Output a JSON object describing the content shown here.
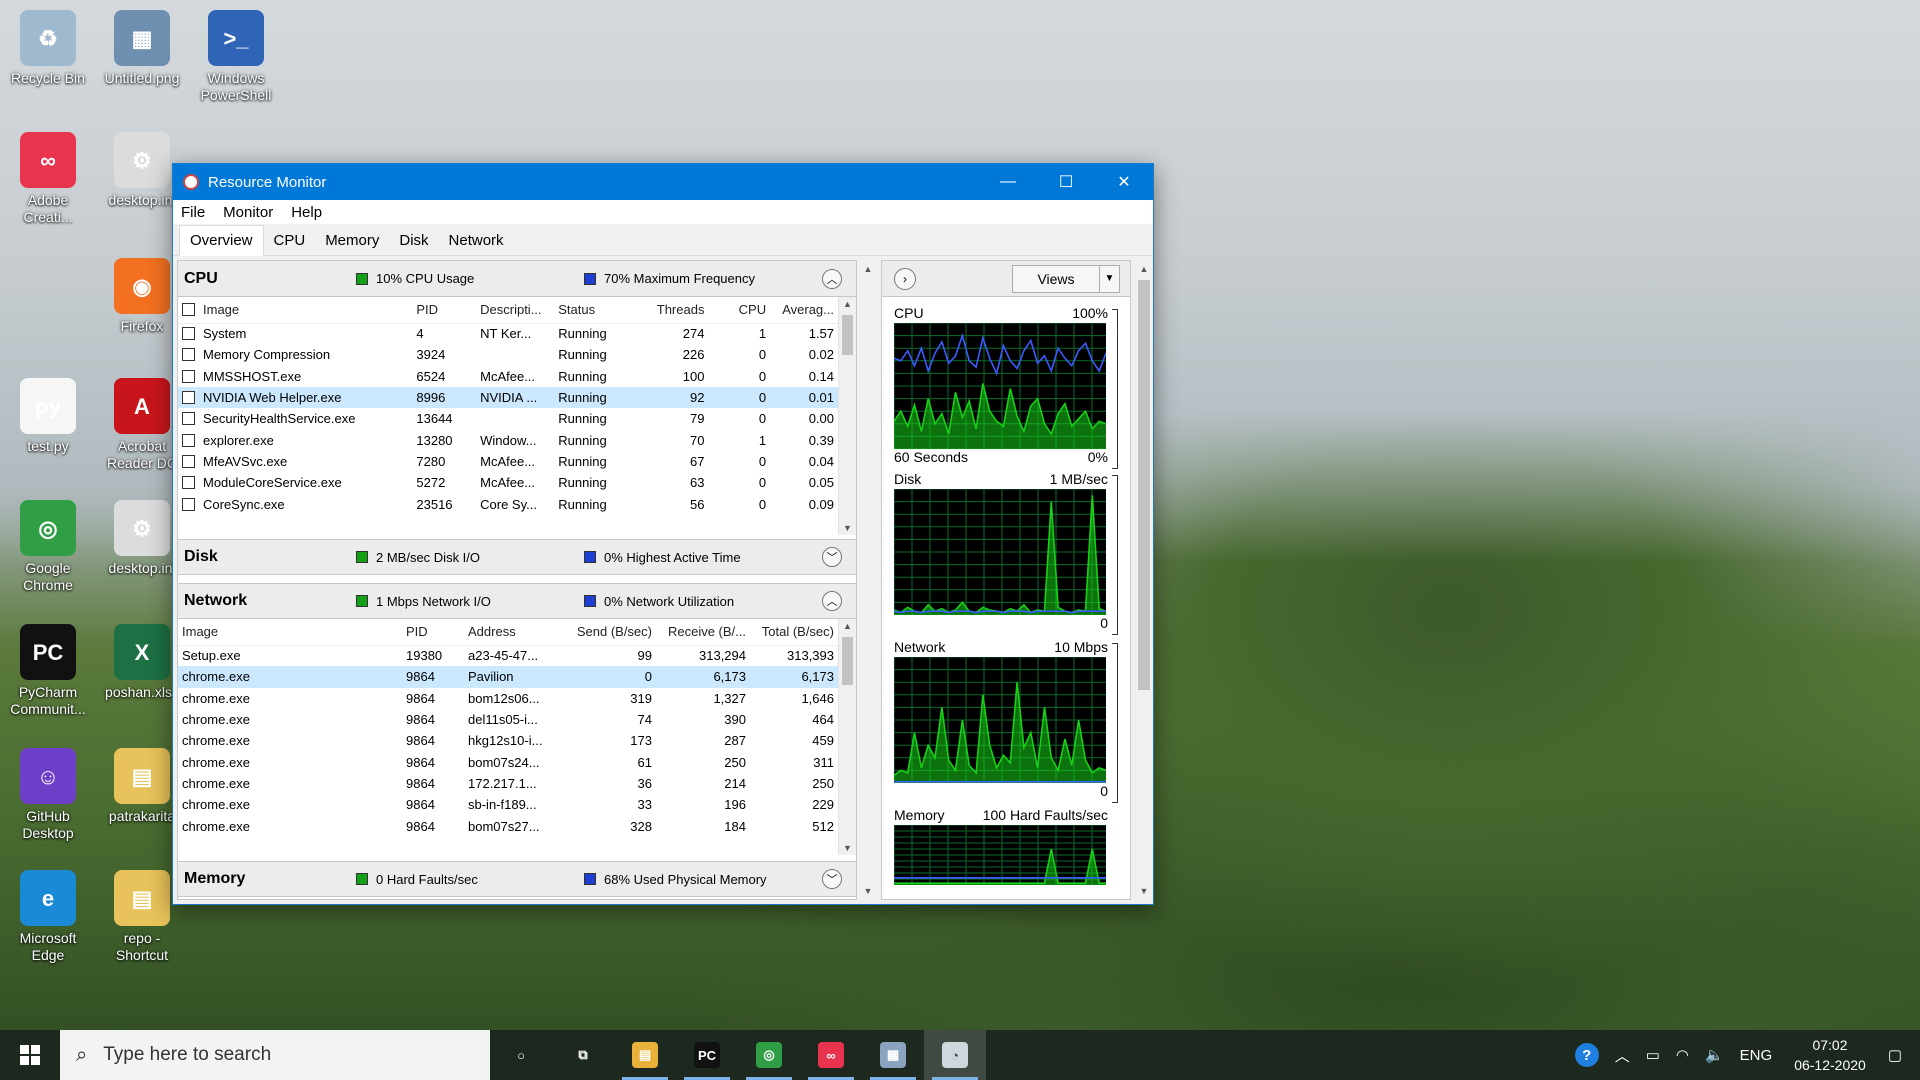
{
  "desktop_icons": [
    {
      "label": "Recycle Bin",
      "icon": "recycle-bin-icon",
      "color": "#9fb9cf",
      "glyph": "♻"
    },
    {
      "label": "Untitled.png",
      "icon": "image-file-icon",
      "color": "#6f8fb0",
      "glyph": "▦"
    },
    {
      "label": "Windows PowerShell",
      "icon": "powershell-icon",
      "color": "#2f64b7",
      "glyph": ">_"
    },
    {
      "label": "Adobe Creati...",
      "icon": "adobe-creative-cloud-icon",
      "color": "#e8344e",
      "glyph": "∞"
    },
    {
      "label": "desktop.ini",
      "icon": "settings-file-icon",
      "color": "#dcdcdc",
      "glyph": "⚙"
    },
    {
      "label": "Firefox",
      "icon": "firefox-icon",
      "color": "#f2701f",
      "glyph": "◉"
    },
    {
      "label": "test.py",
      "icon": "python-file-icon",
      "color": "#f6f6f6",
      "glyph": "py"
    },
    {
      "label": "Acrobat Reader DC",
      "icon": "acrobat-icon",
      "color": "#c8151b",
      "glyph": "A"
    },
    {
      "label": "Google Chrome",
      "icon": "chrome-icon",
      "color": "#2f9e45",
      "glyph": "◎"
    },
    {
      "label": "desktop.ini",
      "icon": "settings-file-icon",
      "color": "#dcdcdc",
      "glyph": "⚙"
    },
    {
      "label": "PyCharm Communit...",
      "icon": "pycharm-icon",
      "color": "#111111",
      "glyph": "PC"
    },
    {
      "label": "poshan.xlsx",
      "icon": "excel-file-icon",
      "color": "#1d7044",
      "glyph": "X"
    },
    {
      "label": "GitHub Desktop",
      "icon": "github-desktop-icon",
      "color": "#6e40c9",
      "glyph": "☺"
    },
    {
      "label": "patrakarita",
      "icon": "folder-icon",
      "color": "#e8c25a",
      "glyph": "▤"
    },
    {
      "label": "Microsoft Edge",
      "icon": "edge-icon",
      "color": "#1b8ad6",
      "glyph": "e"
    },
    {
      "label": "repo - Shortcut",
      "icon": "folder-shortcut-icon",
      "color": "#e8c25a",
      "glyph": "▤"
    }
  ],
  "window": {
    "title": "Resource Monitor",
    "minimize": "—",
    "maximize": "☐",
    "close": "✕",
    "menu": [
      "File",
      "Monitor",
      "Help"
    ],
    "tabs": [
      "Overview",
      "CPU",
      "Memory",
      "Disk",
      "Network"
    ],
    "active_tab": "Overview"
  },
  "cpu": {
    "title": "CPU",
    "stat1": "10% CPU Usage",
    "stat2": "70% Maximum Frequency",
    "columns": [
      "Image",
      "PID",
      "Descripti...",
      "Status",
      "Threads",
      "CPU",
      "Averag..."
    ],
    "rows": [
      [
        "System",
        "4",
        "NT Ker...",
        "Running",
        "274",
        "1",
        "1.57"
      ],
      [
        "Memory Compression",
        "3924",
        "",
        "Running",
        "226",
        "0",
        "0.02"
      ],
      [
        "MMSSHOST.exe",
        "6524",
        "McAfee...",
        "Running",
        "100",
        "0",
        "0.14"
      ],
      [
        "NVIDIA Web Helper.exe",
        "8996",
        "NVIDIA ...",
        "Running",
        "92",
        "0",
        "0.01"
      ],
      [
        "SecurityHealthService.exe",
        "13644",
        "",
        "Running",
        "79",
        "0",
        "0.00"
      ],
      [
        "explorer.exe",
        "13280",
        "Window...",
        "Running",
        "70",
        "1",
        "0.39"
      ],
      [
        "MfeAVSvc.exe",
        "7280",
        "McAfee...",
        "Running",
        "67",
        "0",
        "0.04"
      ],
      [
        "ModuleCoreService.exe",
        "5272",
        "McAfee...",
        "Running",
        "63",
        "0",
        "0.05"
      ],
      [
        "CoreSync.exe",
        "23516",
        "Core Sy...",
        "Running",
        "56",
        "0",
        "0.09"
      ]
    ],
    "selected_row": 3
  },
  "disk": {
    "title": "Disk",
    "stat1": "2 MB/sec Disk I/O",
    "stat2": "0% Highest Active Time"
  },
  "network": {
    "title": "Network",
    "stat1": "1 Mbps Network I/O",
    "stat2": "0% Network Utilization",
    "columns": [
      "Image",
      "PID",
      "Address",
      "Send (B/sec)",
      "Receive (B/...",
      "Total (B/sec)"
    ],
    "rows": [
      [
        "Setup.exe",
        "19380",
        "a23-45-47...",
        "99",
        "313,294",
        "313,393"
      ],
      [
        "chrome.exe",
        "9864",
        "Pavilion",
        "0",
        "6,173",
        "6,173"
      ],
      [
        "chrome.exe",
        "9864",
        "bom12s06...",
        "319",
        "1,327",
        "1,646"
      ],
      [
        "chrome.exe",
        "9864",
        "del11s05-i...",
        "74",
        "390",
        "464"
      ],
      [
        "chrome.exe",
        "9864",
        "hkg12s10-i...",
        "173",
        "287",
        "459"
      ],
      [
        "chrome.exe",
        "9864",
        "bom07s24...",
        "61",
        "250",
        "311"
      ],
      [
        "chrome.exe",
        "9864",
        "172.217.1...",
        "36",
        "214",
        "250"
      ],
      [
        "chrome.exe",
        "9864",
        "sb-in-f189...",
        "33",
        "196",
        "229"
      ],
      [
        "chrome.exe",
        "9864",
        "bom07s27...",
        "328",
        "184",
        "512"
      ]
    ],
    "selected_row": 1
  },
  "memory": {
    "title": "Memory",
    "stat1": "0 Hard Faults/sec",
    "stat2": "68% Used Physical Memory"
  },
  "graphs": {
    "views_label": "Views",
    "cpu": {
      "label": "CPU",
      "max": "100%",
      "foot_left": "60 Seconds",
      "foot_right": "0%"
    },
    "disk": {
      "label": "Disk",
      "max": "1 MB/sec",
      "foot_right": "0"
    },
    "network": {
      "label": "Network",
      "max": "10 Mbps",
      "foot_right": "0"
    },
    "memory": {
      "label": "Memory",
      "max": "100 Hard Faults/sec"
    },
    "series": {
      "cpu_blue": [
        72,
        70,
        78,
        66,
        80,
        62,
        76,
        85,
        68,
        74,
        90,
        70,
        65,
        88,
        72,
        60,
        82,
        70,
        64,
        78,
        86,
        68,
        74,
        62,
        80,
        72,
        66,
        78,
        84,
        70,
        62,
        76
      ],
      "cpu_green": [
        22,
        30,
        18,
        35,
        14,
        40,
        20,
        28,
        12,
        45,
        25,
        38,
        16,
        52,
        30,
        22,
        18,
        48,
        26,
        14,
        34,
        40,
        20,
        12,
        28,
        36,
        18,
        24,
        30,
        16,
        22,
        20
      ],
      "disk_green": [
        4,
        2,
        6,
        3,
        2,
        8,
        3,
        5,
        2,
        4,
        10,
        3,
        2,
        6,
        4,
        3,
        2,
        5,
        3,
        8,
        2,
        4,
        3,
        90,
        6,
        3,
        2,
        4,
        3,
        95,
        5,
        3
      ],
      "net_green": [
        6,
        10,
        8,
        40,
        12,
        30,
        20,
        60,
        18,
        10,
        50,
        14,
        8,
        70,
        30,
        12,
        22,
        16,
        80,
        28,
        40,
        12,
        60,
        20,
        10,
        35,
        14,
        50,
        18,
        8,
        12,
        10
      ]
    },
    "colors": {
      "green": "#18d018",
      "blue": "#3a5cff",
      "grid": "#0b6b2b"
    }
  },
  "taskbar": {
    "search_placeholder": "Type here to search",
    "language": "ENG",
    "time": "07:02",
    "date": "06-12-2020",
    "apps": [
      {
        "name": "cortana-icon",
        "glyph": "○",
        "color": "transparent"
      },
      {
        "name": "task-view-icon",
        "glyph": "⧉",
        "color": "transparent"
      },
      {
        "name": "file-explorer-icon",
        "glyph": "▤",
        "color": "#e8b23a"
      },
      {
        "name": "pycharm-icon",
        "glyph": "PC",
        "color": "#111111"
      },
      {
        "name": "chrome-icon",
        "glyph": "◎",
        "color": "#2f9e45"
      },
      {
        "name": "adobe-creative-cloud-icon",
        "glyph": "∞",
        "color": "#e8344e"
      },
      {
        "name": "photos-icon",
        "glyph": "▦",
        "color": "#8aa4c0"
      },
      {
        "name": "resource-monitor-icon",
        "glyph": "◔",
        "color": "#cfd6dd"
      }
    ]
  }
}
